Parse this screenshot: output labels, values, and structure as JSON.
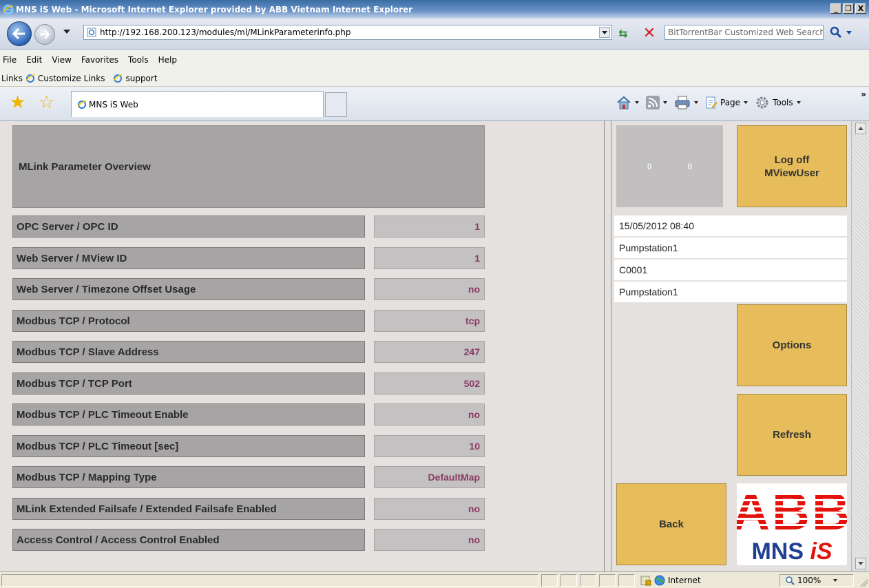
{
  "window": {
    "title": "MNS iS Web - Microsoft Internet Explorer provided by ABB Vietnam Internet Explorer",
    "controls": [
      "_",
      "❐",
      "X"
    ]
  },
  "navigation": {
    "url": "http://192.168.200.123/modules/ml/MLinkParameterinfo.php",
    "search_placeholder": "BitTorrentBar Customized Web Search"
  },
  "menu": [
    "File",
    "Edit",
    "View",
    "Favorites",
    "Tools",
    "Help"
  ],
  "links_bar": {
    "label": "Links",
    "items": [
      "Customize Links",
      "support"
    ]
  },
  "tab": {
    "title": "MNS iS Web"
  },
  "command_bar": {
    "page_label": "Page",
    "tools_label": "Tools",
    "chevron": "»"
  },
  "main": {
    "heading": "MLink Parameter Overview",
    "parameters": [
      {
        "label": "OPC Server / OPC ID",
        "value": "1"
      },
      {
        "label": "Web Server / MView ID",
        "value": "1"
      },
      {
        "label": "Web Server / Timezone Offset Usage",
        "value": "no"
      },
      {
        "label": "Modbus TCP / Protocol",
        "value": "tcp"
      },
      {
        "label": "Modbus TCP / Slave Address",
        "value": "247"
      },
      {
        "label": "Modbus TCP / TCP Port",
        "value": "502"
      },
      {
        "label": "Modbus TCP / PLC Timeout Enable",
        "value": "no"
      },
      {
        "label": "Modbus TCP / PLC Timeout [sec]",
        "value": "10"
      },
      {
        "label": "Modbus TCP / Mapping Type",
        "value": "DefaultMap"
      },
      {
        "label": "MLink Extended Failsafe / Extended Failsafe Enabled",
        "value": "no"
      },
      {
        "label": "Access Control / Access Control Enabled",
        "value": "no"
      }
    ]
  },
  "sidebar": {
    "counters": [
      "0",
      "0"
    ],
    "logoff_label": "Log off\nMViewUser",
    "info": [
      "15/05/2012 08:40",
      "Pumpstation1",
      "C0001",
      "Pumpstation1"
    ],
    "options_label": "Options",
    "refresh_label": "Refresh",
    "back_label": "Back",
    "logo": {
      "brand": "ABB",
      "product_main": "MNS ",
      "product_italic": "iS"
    }
  },
  "status_bar": {
    "zone": "Internet",
    "zoom": "100%"
  },
  "colors": {
    "panel_gray": "#a7a4a6",
    "value_text": "#8a3a62",
    "button_yellow": "#e6bd5a",
    "abb_red": "#e3120b",
    "mns_blue": "#1f3f92"
  }
}
